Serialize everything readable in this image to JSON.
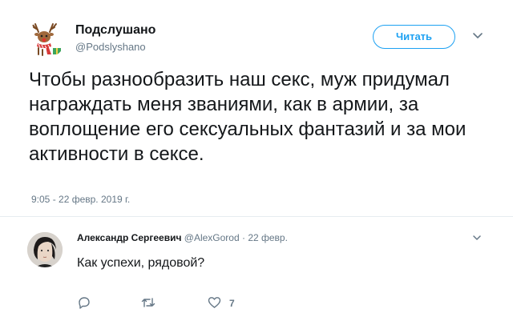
{
  "tweet": {
    "author": {
      "name": "Подслушано",
      "handle": "@Podslyshano"
    },
    "follow_label": "Читать",
    "text": "Чтобы разнообразить наш секс, муж придумал награждать меня званиями, как в армии, за воплощение его сексуальных фантазий и за мои активности в сексе.",
    "timestamp": "9:05 - 22 февр. 2019 г."
  },
  "reply": {
    "author_name": "Александр Сергеевич",
    "handle": "@AlexGorod",
    "separator": " · ",
    "date": "22 февр.",
    "text": "Как успехи, рядовой?",
    "actions": {
      "reply_icon": "reply-icon",
      "retweet_icon": "retweet-icon",
      "like_icon": "heart-icon",
      "like_count": "7"
    }
  },
  "colors": {
    "accent": "#1da1f2",
    "secondary_text": "#657786",
    "text": "#14171a",
    "divider": "#e6ecf0"
  }
}
